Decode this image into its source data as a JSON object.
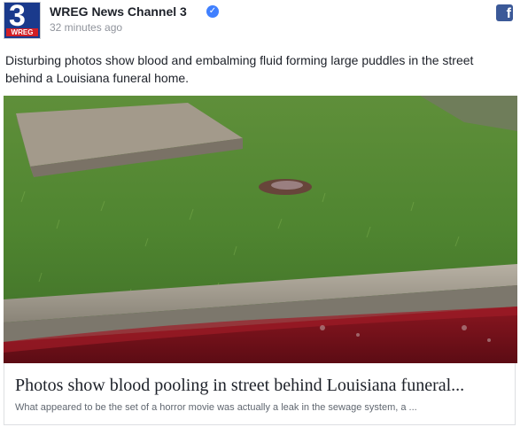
{
  "post": {
    "page_name": "WREG News Channel 3",
    "time": "32 minutes ago",
    "logo": {
      "number": "3",
      "tag": "WREG",
      "brand_color": "#1a3a8c",
      "tag_color": "#d21f26"
    },
    "verified_icon": "verified-check-icon",
    "share_icon": "facebook-icon",
    "text": "Disturbing photos show blood and embalming fluid forming large puddles in the street behind a Louisiana funeral home."
  },
  "link_card": {
    "title": "Photos show blood pooling in street behind Louisiana funeral...",
    "description": "What appeared to be the set of a horror movie was actually a leak in the sewage system, a ..."
  }
}
